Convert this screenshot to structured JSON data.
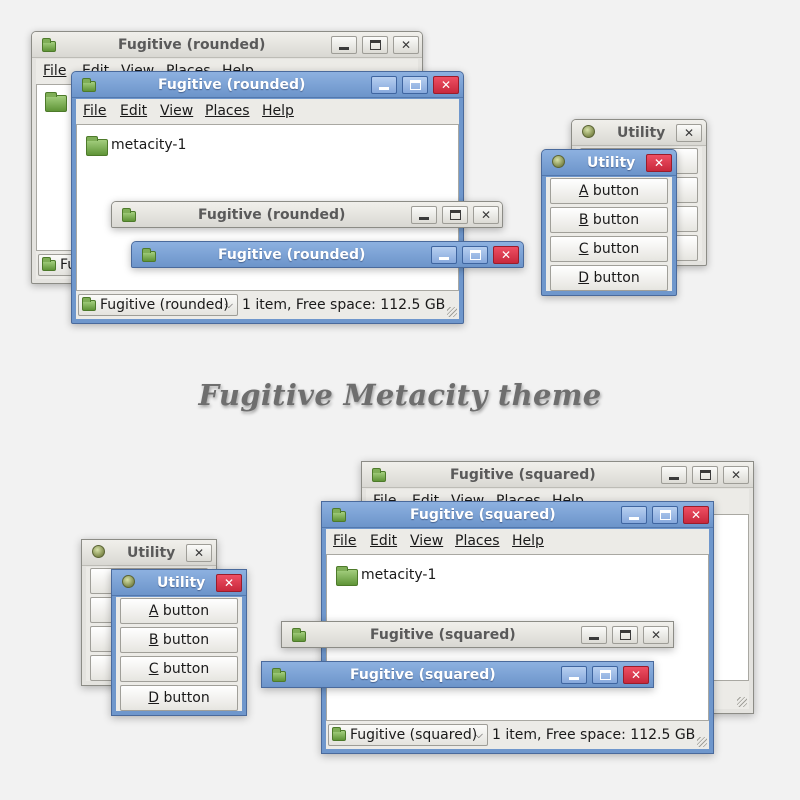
{
  "headline": "Fugitive Metacity theme",
  "colors": {
    "background": "#f2f2f2",
    "active_frame": "#6f97cc",
    "inactive_frame": "#e4e3df",
    "close_button": "#d63347",
    "folder_green": "#7fae57"
  },
  "icons": {
    "folder": "folder-icon",
    "utility": "utility-app-icon",
    "minimize": "minimize-icon",
    "maximize": "maximize-icon",
    "close": "close-icon"
  },
  "rounded": {
    "back_window": {
      "title": "Fugitive (rounded)",
      "menu_visible": [
        "File",
        "Edit",
        "View",
        "Places",
        "Help"
      ],
      "status_fragment": "Fu"
    },
    "file_window": {
      "title": "Fugitive (rounded)",
      "menu": [
        "File",
        "Edit",
        "View",
        "Places",
        "Help"
      ],
      "file_name": "metacity-1",
      "location_combo": "Fugitive (rounded)",
      "status": "1 item, Free space: 112.5 GB"
    },
    "inactive_titlebar": {
      "title": "Fugitive (rounded)"
    },
    "active_titlebar": {
      "title": "Fugitive (rounded)"
    },
    "utility_back": {
      "title": "Utility"
    },
    "utility_front": {
      "title": "Utility",
      "buttons": [
        {
          "key": "A",
          "rest": " button"
        },
        {
          "key": "B",
          "rest": " button"
        },
        {
          "key": "C",
          "rest": " button"
        },
        {
          "key": "D",
          "rest": " button"
        }
      ]
    }
  },
  "squared": {
    "back_window": {
      "title": "Fugitive (squared)",
      "menu_visible": [
        "File",
        "Edit",
        "View",
        "Places",
        "Help"
      ]
    },
    "file_window": {
      "title": "Fugitive (squared)",
      "menu": [
        "File",
        "Edit",
        "View",
        "Places",
        "Help"
      ],
      "file_name": "metacity-1",
      "location_combo": "Fugitive (squared)",
      "status": "1 item, Free space: 112.5 GB"
    },
    "inactive_titlebar": {
      "title": "Fugitive (squared)"
    },
    "active_titlebar": {
      "title": "Fugitive (squared)"
    },
    "utility_back": {
      "title": "Utility"
    },
    "utility_front": {
      "title": "Utility",
      "buttons": [
        {
          "key": "A",
          "rest": " button"
        },
        {
          "key": "B",
          "rest": " button"
        },
        {
          "key": "C",
          "rest": " button"
        },
        {
          "key": "D",
          "rest": " button"
        }
      ]
    }
  }
}
